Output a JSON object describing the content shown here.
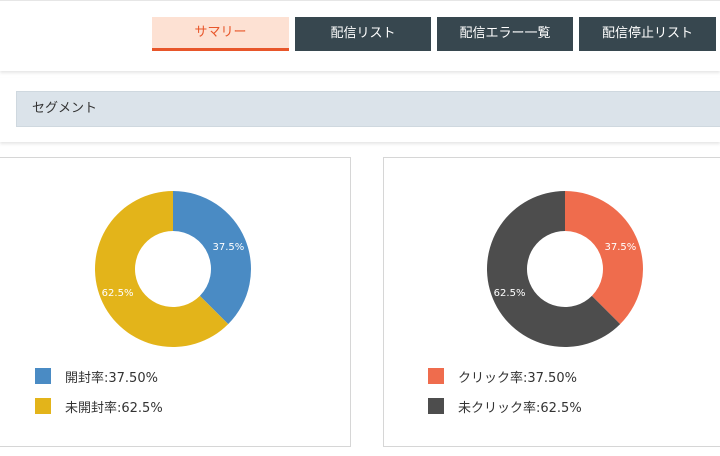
{
  "tabs": [
    {
      "label": "サマリー",
      "active": true
    },
    {
      "label": "配信リスト",
      "active": false
    },
    {
      "label": "配信エラー一覧",
      "active": false
    },
    {
      "label": "配信停止リスト",
      "active": false
    }
  ],
  "segment": {
    "label": "セグメント"
  },
  "charts": [
    {
      "legend": [
        {
          "label": "開封率:37.50%",
          "color": "#4a8bc4"
        },
        {
          "label": "未開封率:62.5%",
          "color": "#e3b41a"
        }
      ]
    },
    {
      "legend": [
        {
          "label": "クリック率:37.50%",
          "color": "#ef6c4d"
        },
        {
          "label": "未クリック率:62.5%",
          "color": "#4d4d4d"
        }
      ]
    }
  ],
  "chart_data": [
    {
      "type": "pie",
      "categories": [
        "開封率",
        "未開封率"
      ],
      "values": [
        37.5,
        62.5
      ],
      "labels": [
        "37.5%",
        "62.5%"
      ],
      "colors": [
        "#4a8bc4",
        "#e3b41a"
      ]
    },
    {
      "type": "pie",
      "categories": [
        "クリック率",
        "未クリック率"
      ],
      "values": [
        37.5,
        62.5
      ],
      "labels": [
        "37.5%",
        "62.5%"
      ],
      "colors": [
        "#ef6c4d",
        "#4d4d4d"
      ]
    }
  ]
}
